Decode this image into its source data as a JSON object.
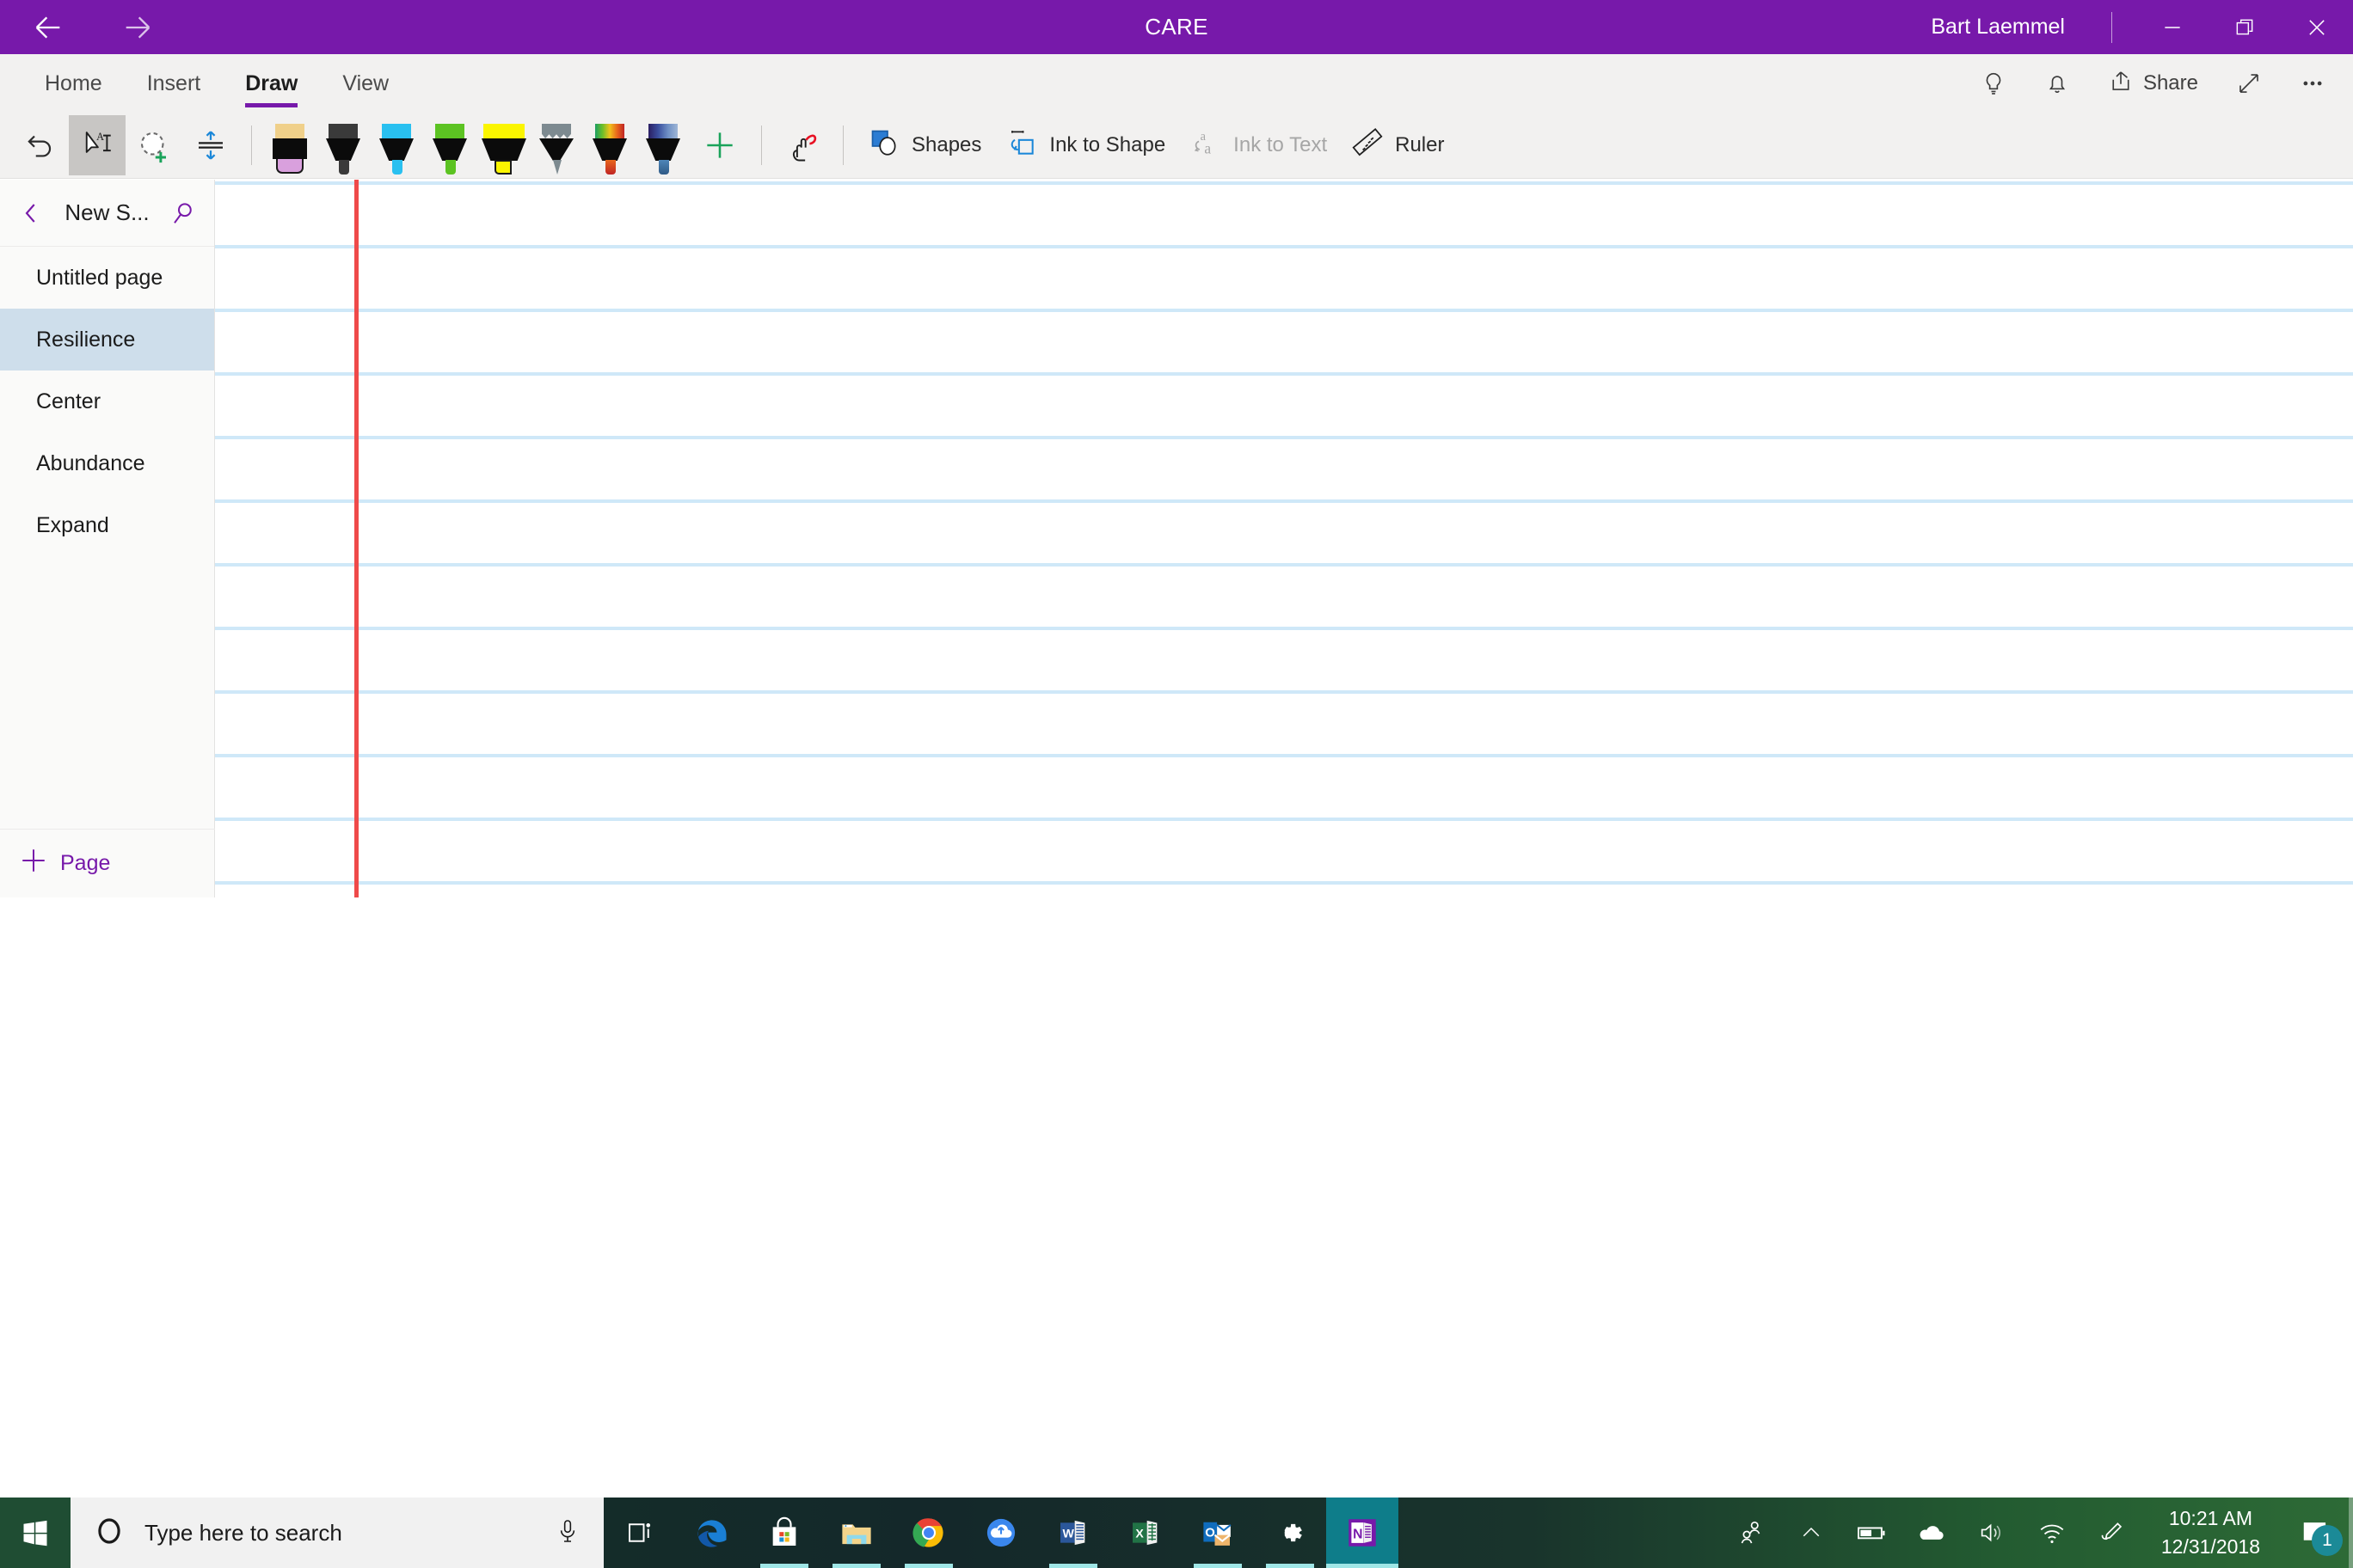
{
  "titlebar": {
    "back_icon": "back-arrow-icon",
    "forward_icon": "forward-arrow-icon",
    "title": "CARE",
    "user": "Bart Laemmel",
    "minimize_label": "─",
    "restore_icon": "restore-window-icon",
    "close_label": "✕",
    "color": "#7719aa"
  },
  "ribbon": {
    "tabs": [
      {
        "label": "Home",
        "active": false
      },
      {
        "label": "Insert",
        "active": false
      },
      {
        "label": "Draw",
        "active": true
      },
      {
        "label": "View",
        "active": false
      }
    ],
    "active_tab": "Draw",
    "accent_color": "#7719aa",
    "right_actions": [
      {
        "label": "",
        "icon": "lightbulb-icon"
      },
      {
        "label": "",
        "icon": "bell-icon"
      },
      {
        "label": "Share",
        "icon": "share-icon"
      },
      {
        "label": "",
        "icon": "expand-diagonal-icon"
      },
      {
        "label": "",
        "icon": "more-ellipsis-icon"
      }
    ],
    "share_label": "Share"
  },
  "toolbar": {
    "undo_label": "Undo",
    "select_label": "Type / Select Objects",
    "lasso_label": "Lasso Select",
    "insert_space_label": "Insert Space",
    "add_pen_label": "Add Pen",
    "draw_with_touch_label": "Draw with Touch",
    "shapes_label": "Shapes",
    "ink_to_shape_label": "Ink to Shape",
    "ink_to_text_label": "Ink to Text",
    "ink_to_text_disabled": true,
    "ruler_label": "Ruler",
    "pens": [
      {
        "name": "eraser",
        "cap": "#f0d08a",
        "tip": "#d9a0dd",
        "type": "eraser"
      },
      {
        "name": "black-pen",
        "cap": "#3a3a3a",
        "tip": "#3a3a3a",
        "type": "pen"
      },
      {
        "name": "cyan-pen",
        "cap": "#29c0f0",
        "tip": "#29c0f0",
        "type": "pen"
      },
      {
        "name": "green-pen",
        "cap": "#5cc322",
        "tip": "#5cc322",
        "type": "pen"
      },
      {
        "name": "yellow-highlighter",
        "cap": "#fbf500",
        "tip": "#fbf500",
        "type": "highlighter"
      },
      {
        "name": "gray-pencil",
        "cap": "#7d8a90",
        "tip": "#7d8a90",
        "type": "pencil"
      },
      {
        "name": "rainbow-pen",
        "cap": "linear-gradient(90deg,#1d9e62,#6bbf2a,#f0c21c,#e8671c,#c02424)",
        "tip": "linear-gradient(180deg,#e8671c,#c02424)",
        "type": "pen"
      },
      {
        "name": "galaxy-pen",
        "cap": "linear-gradient(90deg,#2b1f63,#3a4f9e,#6e8fc4,#9fb6d6)",
        "tip": "linear-gradient(180deg,#4f86b8,#2f5a86)",
        "type": "pen"
      }
    ]
  },
  "sidebar": {
    "back_icon": "chevron-left-icon",
    "section_title": "New S...",
    "search_icon": "search-icon",
    "pages": [
      {
        "label": "Untitled page",
        "selected": false
      },
      {
        "label": "Resilience",
        "selected": true
      },
      {
        "label": "Center",
        "selected": false
      },
      {
        "label": "Abundance",
        "selected": false
      },
      {
        "label": "Expand",
        "selected": false
      }
    ],
    "add_page_label": "Page",
    "add_page_icon": "plus-icon",
    "selected_color": "#cedeeb",
    "accent_color": "#7719aa"
  },
  "canvas": {
    "rule_color": "#cfe8f8",
    "margin_color": "#ef4a4a",
    "rule_spacing": 74,
    "rule_count": 12,
    "margin_x": 162,
    "content": ""
  },
  "taskbar": {
    "start_icon": "windows-start-icon",
    "search_placeholder": "Type here to search",
    "cortana_icon": "cortana-circle-icon",
    "mic_icon": "microphone-icon",
    "apps": [
      {
        "name": "task-view-icon",
        "label": "Task View",
        "state": "idle"
      },
      {
        "name": "edge-icon",
        "label": "Microsoft Edge",
        "state": "idle"
      },
      {
        "name": "microsoft-store-icon",
        "label": "Microsoft Store",
        "state": "running"
      },
      {
        "name": "file-explorer-icon",
        "label": "File Explorer",
        "state": "running"
      },
      {
        "name": "chrome-icon",
        "label": "Google Chrome",
        "state": "running"
      },
      {
        "name": "onedrive-icon",
        "label": "OneDrive",
        "state": "idle"
      },
      {
        "name": "word-icon",
        "label": "Word",
        "state": "running"
      },
      {
        "name": "excel-icon",
        "label": "Excel",
        "state": "idle"
      },
      {
        "name": "outlook-icon",
        "label": "Outlook",
        "state": "running"
      },
      {
        "name": "settings-icon",
        "label": "Settings",
        "state": "running"
      },
      {
        "name": "onenote-icon",
        "label": "OneNote",
        "state": "active"
      }
    ],
    "tray": [
      {
        "name": "people-icon"
      },
      {
        "name": "chevron-up-icon"
      },
      {
        "name": "battery-icon"
      },
      {
        "name": "onedrive-cloud-icon"
      },
      {
        "name": "volume-icon"
      },
      {
        "name": "wifi-icon"
      },
      {
        "name": "pen-workspace-icon"
      }
    ],
    "clock_time": "10:21 AM",
    "clock_date": "12/31/2018",
    "notification_icon": "action-center-icon",
    "notification_count": "1"
  }
}
